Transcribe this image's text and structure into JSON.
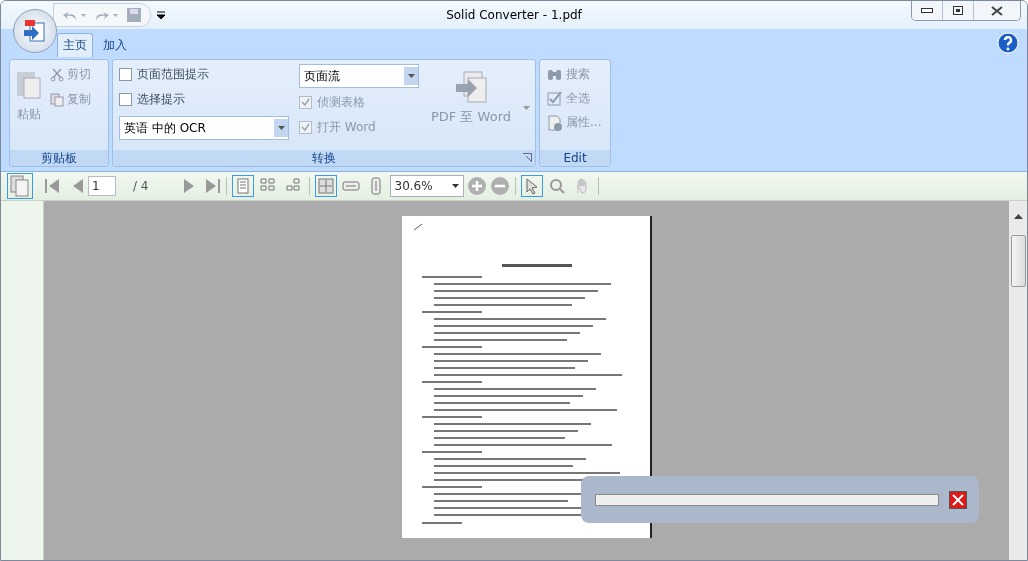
{
  "window": {
    "title": "Solid Converter - 1.pdf"
  },
  "tabs": [
    {
      "label": "主页",
      "selected": true
    },
    {
      "label": "加入",
      "selected": false
    }
  ],
  "clipboard": {
    "title": "剪贴板",
    "paste": "粘贴",
    "cut": "剪切",
    "copy": "复制"
  },
  "convert": {
    "title": "转换",
    "ocr_select": "英语 中的 OCR",
    "layout_select": "页面流",
    "convert_button": "PDF 至 Word",
    "checks": [
      {
        "label": "页面范围提示",
        "checked": false,
        "disabled": false
      },
      {
        "label": "选择提示",
        "checked": false,
        "disabled": false
      },
      {
        "label": "侦测表格",
        "checked": true,
        "disabled": true
      },
      {
        "label": "打开 Word",
        "checked": true,
        "disabled": true
      }
    ]
  },
  "edit": {
    "title": "Edit",
    "items": [
      {
        "kind": "search",
        "label": "搜索"
      },
      {
        "kind": "select_all",
        "label": "全选"
      },
      {
        "kind": "properties",
        "label": "属性..."
      }
    ]
  },
  "toolbar": {
    "page": "1",
    "total": "/ 4",
    "zoom": "30.6%",
    "page_views": [
      {
        "kind": "single",
        "selected": true
      },
      {
        "kind": "double",
        "selected": false
      },
      {
        "kind": "grid",
        "selected": false
      }
    ],
    "fit_modes": [
      {
        "kind": "page",
        "selected": true
      },
      {
        "kind": "width",
        "selected": false
      },
      {
        "kind": "height",
        "selected": false
      }
    ],
    "pointer_tools": [
      {
        "kind": "select",
        "selected": true
      },
      {
        "kind": "zoom",
        "selected": false
      },
      {
        "kind": "hand",
        "selected": false
      }
    ]
  },
  "progress": {
    "level": 0
  }
}
